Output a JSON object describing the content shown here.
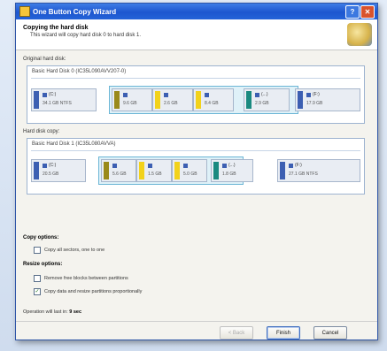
{
  "window": {
    "title": "One Button Copy Wizard",
    "help": "?",
    "close": "✕"
  },
  "header": {
    "title": "Copying the hard disk",
    "subtitle": "This wizard will copy hard disk 0 to hard disk 1."
  },
  "original": {
    "label": "Original hard disk:",
    "disk_title": "Basic Hard Disk 0 (IC35L090AVV207-0)",
    "partitions": [
      {
        "name": "(C:)",
        "size": "34.1 GB NTFS",
        "color": "#3c5fb2"
      },
      {
        "name": "",
        "size": "9.6 GB",
        "color": "#9a8a1a"
      },
      {
        "name": "",
        "size": "2.6 GB",
        "color": "#f2d21b"
      },
      {
        "name": "",
        "size": "8.4 GB",
        "color": "#f2d21b"
      },
      {
        "name": "(...)",
        "size": "2.9 GB",
        "color": "#1a8a80"
      },
      {
        "name": "(F:)",
        "size": "17.9 GB",
        "color": "#3c5fb2"
      }
    ]
  },
  "copy": {
    "label": "Hard disk copy:",
    "disk_title": "Basic Hard Disk 1 (IC35L080AVVA)",
    "partitions": [
      {
        "name": "(C:)",
        "size": "20.5 GB",
        "color": "#3c5fb2"
      },
      {
        "name": "",
        "size": "5.6 GB",
        "color": "#9a8a1a"
      },
      {
        "name": "",
        "size": "1.5 GB",
        "color": "#f2d21b"
      },
      {
        "name": "",
        "size": "5.0 GB",
        "color": "#f2d21b"
      },
      {
        "name": "(...)",
        "size": "1.8 GB",
        "color": "#1a8a80"
      },
      {
        "name": "(F:)",
        "size": "27.1 GB NTFS",
        "color": "#3c5fb2"
      }
    ]
  },
  "copy_options": {
    "label": "Copy options:",
    "sector_by_sector": "Copy all sectors, one to one",
    "sector_checked": false
  },
  "resize_options": {
    "label": "Resize options:",
    "remove_free": "Remove free blocks between partitions",
    "remove_free_checked": false,
    "proportional": "Copy data and resize partitions proportionally",
    "proportional_checked": true
  },
  "duration": {
    "prefix": "Operation will last in:",
    "value": "9 sec"
  },
  "buttons": {
    "back": "< Back",
    "finish": "Finish",
    "cancel": "Cancel"
  }
}
